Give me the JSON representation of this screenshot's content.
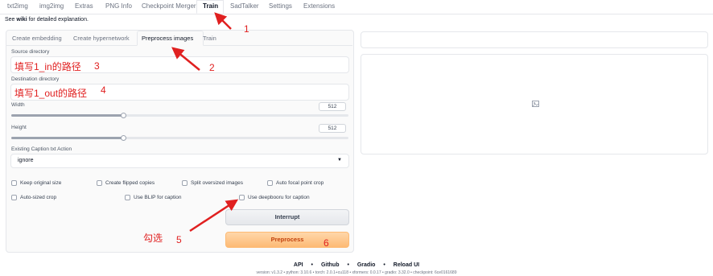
{
  "top_tabs": [
    "txt2img",
    "img2img",
    "Extras",
    "PNG Info",
    "Checkpoint Merger",
    "Train",
    "SadTalker",
    "Settings",
    "Extensions"
  ],
  "active_top_tab": "Train",
  "wiki_text": {
    "prefix": "See ",
    "link": "wiki",
    "suffix": " for detailed explanation."
  },
  "sub_tabs": [
    "Create embedding",
    "Create hypernetwork",
    "Preprocess images",
    "Train"
  ],
  "active_sub_tab": "Preprocess images",
  "source": {
    "label": "Source directory",
    "value": "填写1_in的路径"
  },
  "destination": {
    "label": "Destination directory",
    "value": "填写1_out的路径"
  },
  "width": {
    "label": "Width",
    "value": "512",
    "fraction": 0.333
  },
  "height": {
    "label": "Height",
    "value": "512",
    "fraction": 0.333
  },
  "caption_action": {
    "label": "Existing Caption txt Action",
    "value": "ignore"
  },
  "checkboxes_row1": [
    "Keep original size",
    "Create flipped copies",
    "Split oversized images",
    "Auto focal point crop"
  ],
  "checkboxes_row2": [
    "Auto-sized crop",
    "Use BLIP for caption",
    "Use deepbooru for caption"
  ],
  "buttons": {
    "interrupt": "Interrupt",
    "preprocess": "Preprocess"
  },
  "annotations": {
    "n1": "1",
    "n2": "2",
    "n3": "3",
    "n4": "4",
    "n5": "5",
    "n6": "6",
    "check_note": "勾选"
  },
  "annotation_color": "#e02020",
  "accent_color": "#fdba74",
  "footer": {
    "links": [
      "API",
      "Github",
      "Gradio",
      "Reload UI"
    ],
    "separator": "•",
    "version": "version: v1.3.2  •  python: 3.10.6  •  torch: 2.0.1+cu118  •  xformers: 0.0.17  •  gradio: 3.32.0  •  checkpoint: 6ce0161689"
  },
  "icons": {
    "image_placeholder": "image-icon",
    "dropdown": "chevron-down-icon"
  }
}
